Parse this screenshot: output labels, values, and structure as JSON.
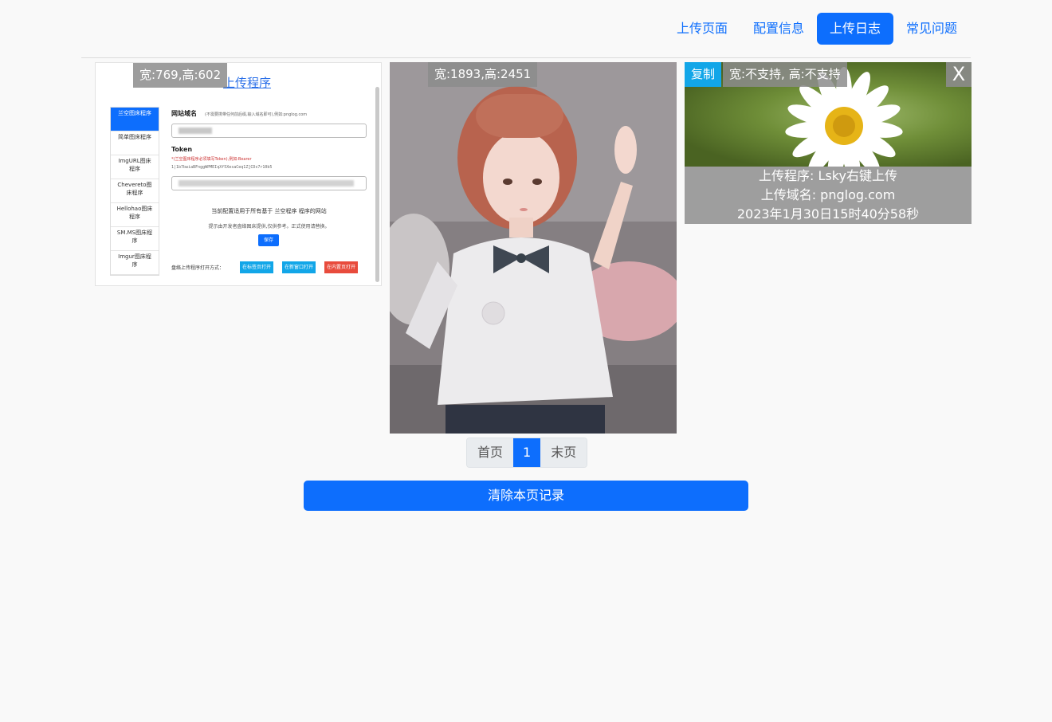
{
  "nav": {
    "items": [
      {
        "label": "上传页面",
        "active": false
      },
      {
        "label": "配置信息",
        "active": false
      },
      {
        "label": "上传日志",
        "active": true
      },
      {
        "label": "常见问题",
        "active": false
      }
    ]
  },
  "cards": [
    {
      "size_label": "宽:769,高:602",
      "screenshot": {
        "title": "上传程序",
        "sidebar": [
          "兰空图床程序",
          "简单图床程序",
          "ImgURL图床程序",
          "Chevereto图床程序",
          "Hellohao图床程序",
          "SM.MS图床程序",
          "Imgur图床程序"
        ],
        "domain_label": "网站域名",
        "domain_note": "(不需要携带任何前后缀,输入域名即可),例如:pnglog.com",
        "token_label": "Token",
        "token_note": "*(兰空图床程序必须填写Token),例如:Bearer",
        "token_example": "1|1b7bwiaBFnggWPMEIqXf5XesaCeq1Z]CDs7r10b5",
        "applies_note": "当前配置适用于所有基于 兰空程序 程序的网站",
        "provider_note": "提示由开发者盘络图床提供,仅供参考。正式使用请替换。",
        "save_label": "保存",
        "open_label": "盘络上传程序打开方式：",
        "open_buttons": [
          "在标签页打开",
          "在新窗口打开",
          "在内置页打开"
        ]
      }
    },
    {
      "size_label": "宽:1893,高:2451"
    },
    {
      "copy_label": "复制",
      "size_label": "宽:不支持, 高:不支持",
      "close_label": "X",
      "info": {
        "uploader": "上传程序: Lsky右键上传",
        "domain": "上传域名: pnglog.com",
        "time": "2023年1月30日15时40分58秒"
      }
    }
  ],
  "pager": {
    "first": "首页",
    "current": "1",
    "last": "末页"
  },
  "clear_button": "清除本页记录",
  "colors": {
    "primary": "#0d6efd",
    "copy": "#12a6e8",
    "background": "#f9f9f9"
  }
}
